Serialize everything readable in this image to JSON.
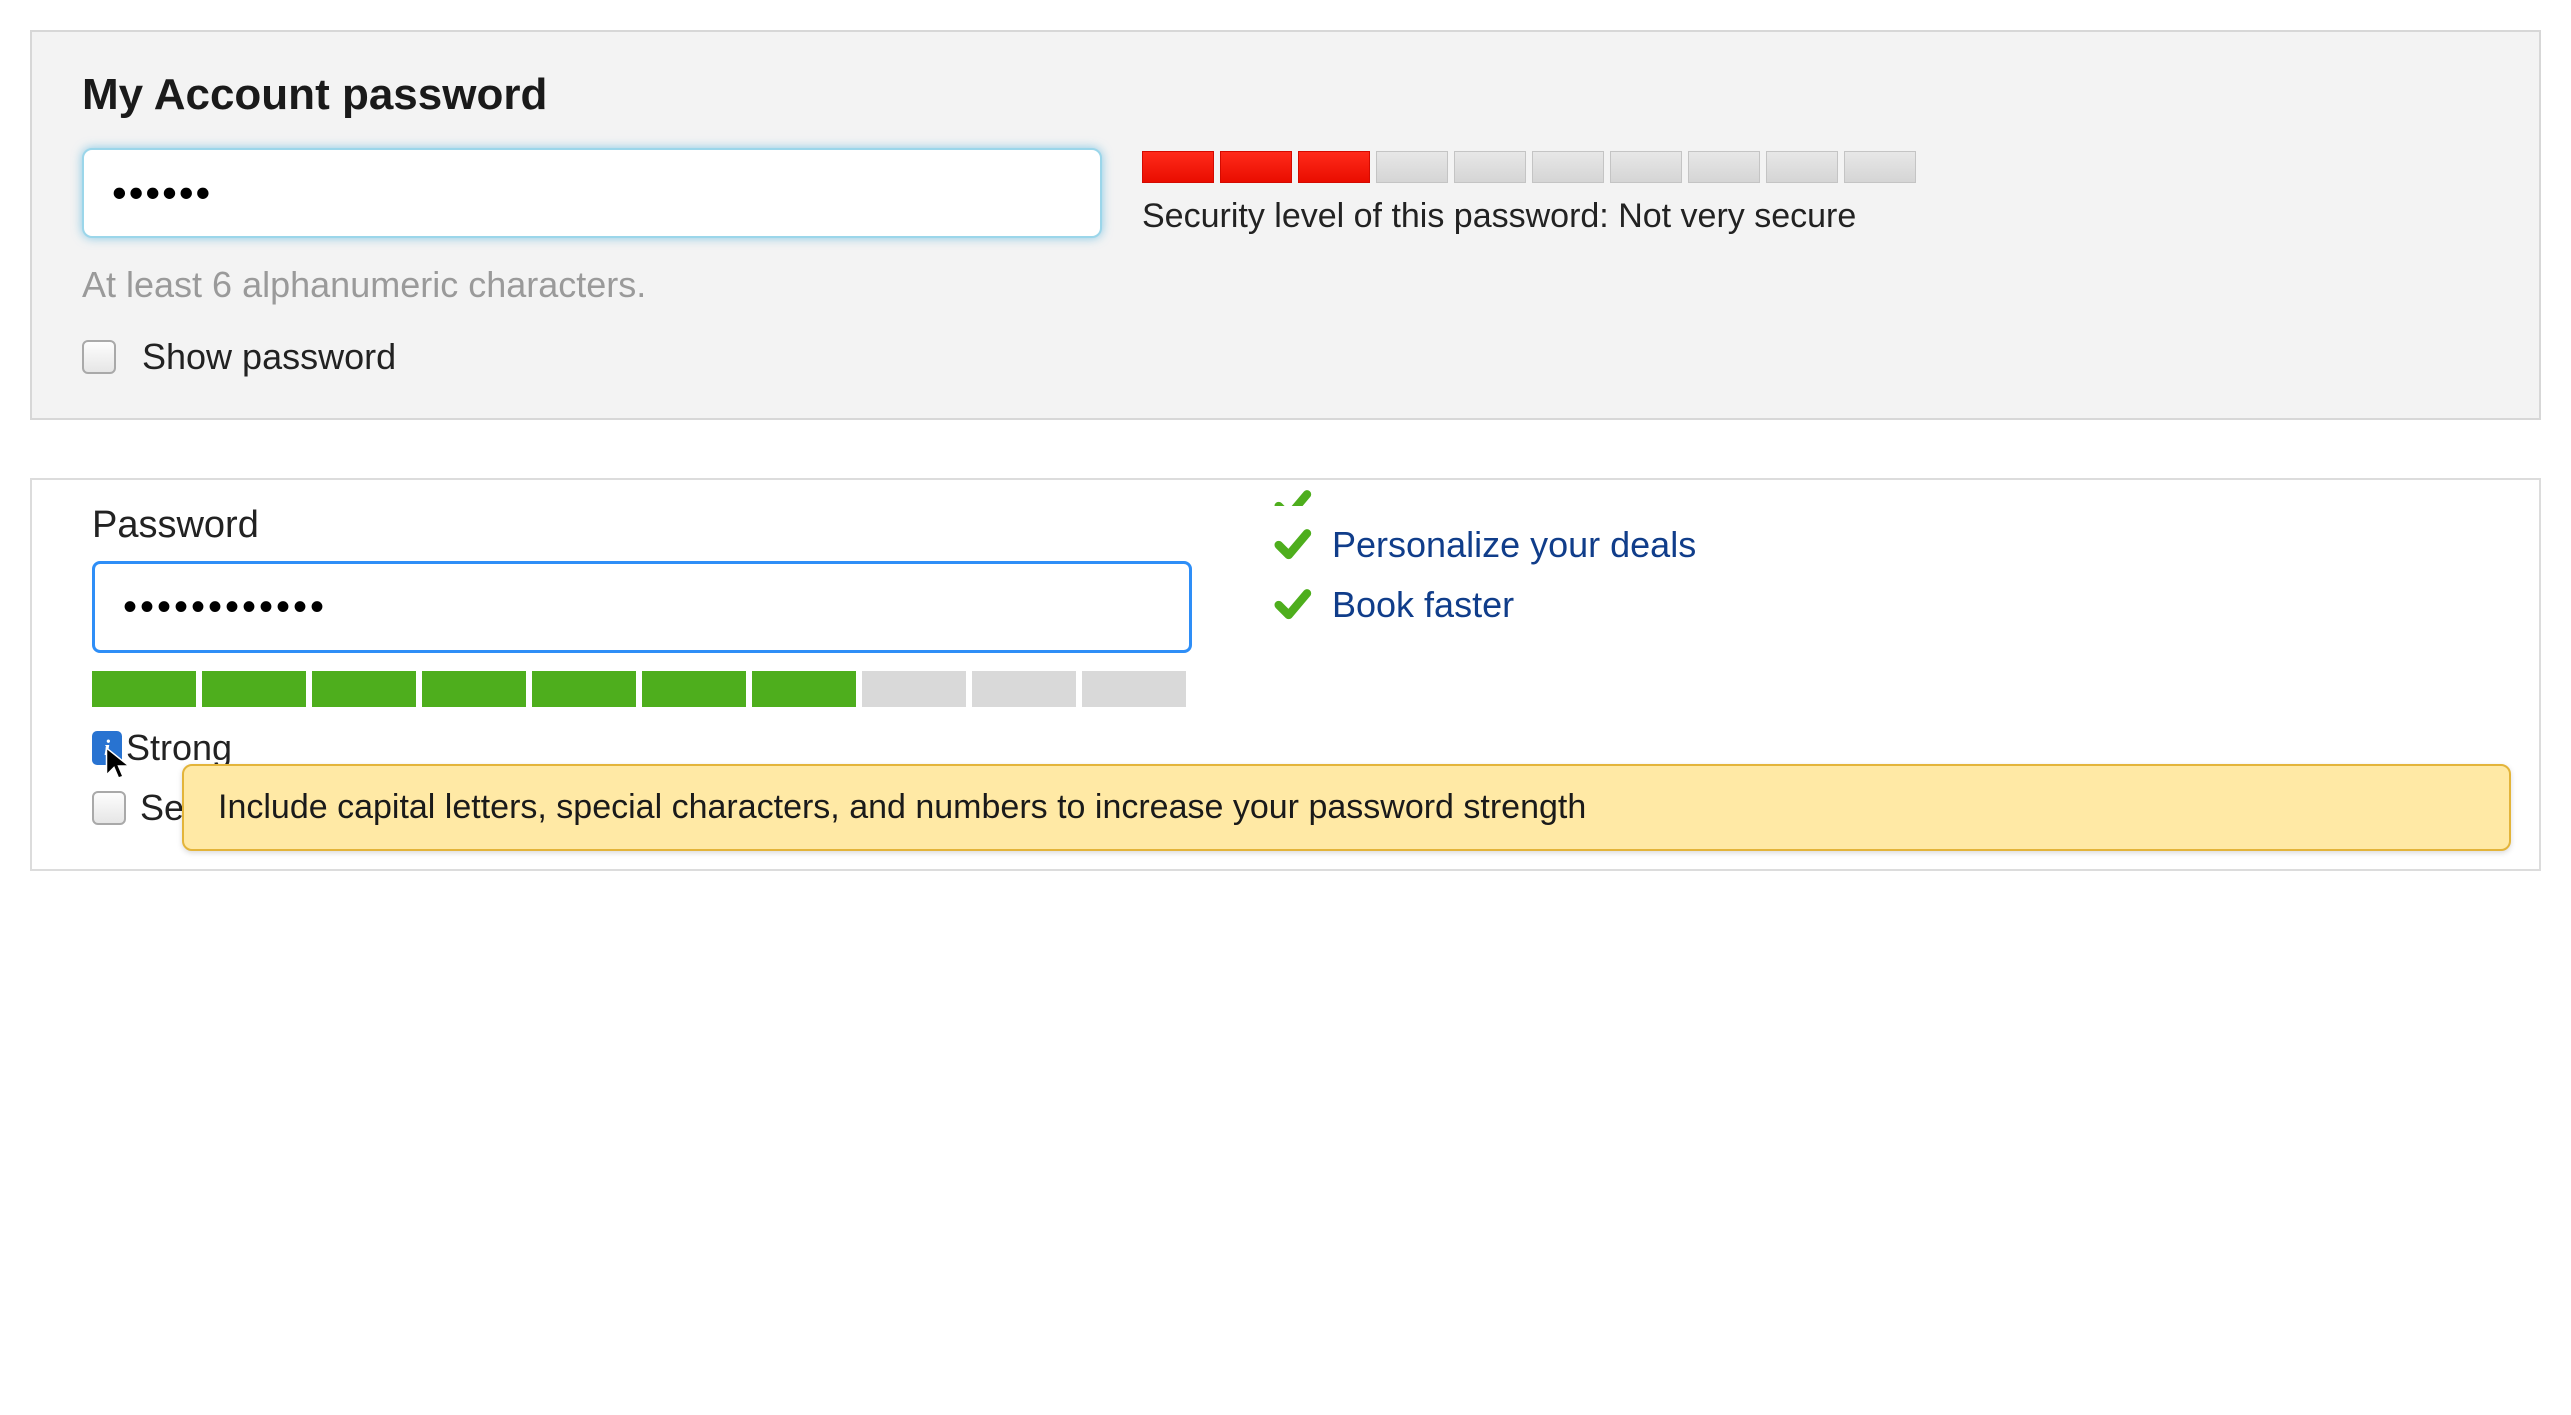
{
  "panel1": {
    "title": "My Account password",
    "password_value": "••••••",
    "meter": {
      "segments": 10,
      "filled": 3,
      "fill_color": "red"
    },
    "security_label": "Security level of this password: Not very secure",
    "hint": "At least 6 alphanumeric characters.",
    "show_password_label": "Show password"
  },
  "panel2": {
    "label": "Password",
    "password_value": "••••••••••••",
    "meter": {
      "segments": 10,
      "filled": 7,
      "fill_color": "green"
    },
    "strength_label": "Strong",
    "info_icon_char": "i",
    "send_checkbox_visible_text": "Se",
    "benefits": {
      "item0_partial": " ",
      "item1": "Personalize your deals",
      "item2": "Book faster"
    },
    "tooltip_text": "Include capital letters, special characters, and numbers to increase your password strength"
  },
  "colors": {
    "red": "#f01000",
    "green": "#4eae1d",
    "blue_border": "#2e8ef7",
    "tooltip_bg": "#ffe9a5",
    "dark_blue_text": "#103d8a"
  }
}
